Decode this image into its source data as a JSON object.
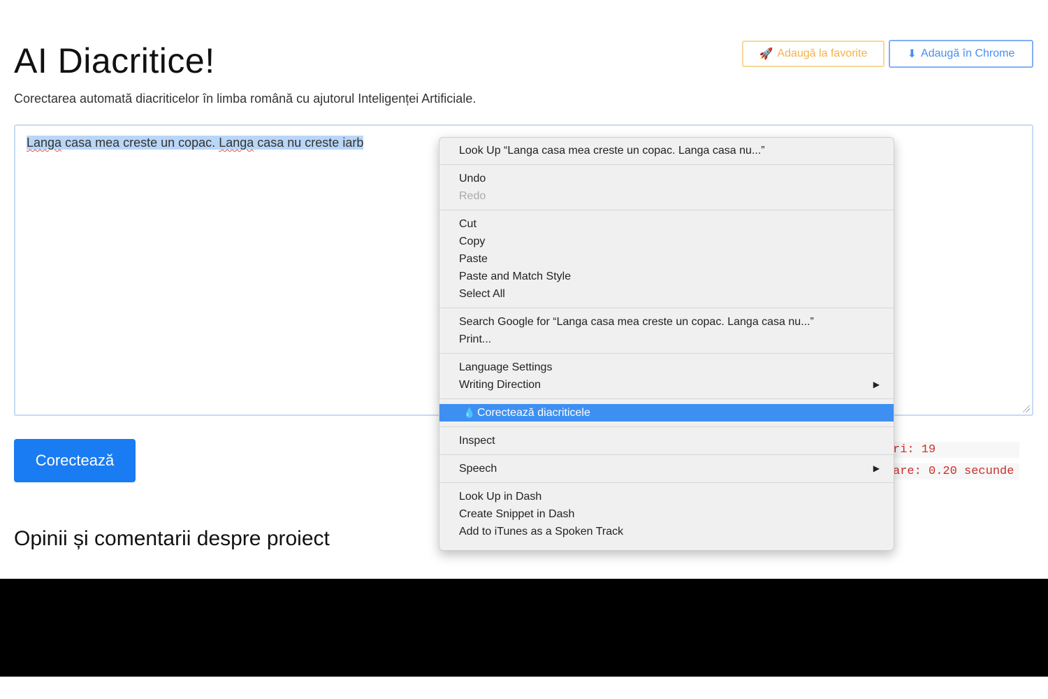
{
  "header": {
    "title": "AI Diacritice!",
    "subtitle": "Corectarea automată diacriticelor în limba română cu ajutorul Inteligenței Artificiale."
  },
  "buttons": {
    "favorites_label": "Adaugă la favorite",
    "chrome_label": "Adaugă în Chrome",
    "correct_label": "Corectează"
  },
  "editor": {
    "w1": "Langa",
    "t1": " casa mea creste un copac. ",
    "w2": "Langa",
    "t2": " casa nu creste iarb"
  },
  "stats": {
    "line1": "ri: 19",
    "line2": "are: 0.20 secunde"
  },
  "section": {
    "heading": "Opinii și comentarii despre proiect"
  },
  "context_menu": {
    "look_up": "Look Up “Langa casa mea creste un copac. Langa casa nu...”",
    "undo": "Undo",
    "redo": "Redo",
    "cut": "Cut",
    "copy": "Copy",
    "paste": "Paste",
    "paste_match": "Paste and Match Style",
    "select_all": "Select All",
    "search_google": "Search Google for “Langa casa mea creste un copac. Langa casa nu...”",
    "print": "Print...",
    "language_settings": "Language Settings",
    "writing_direction": "Writing Direction",
    "correct_diacritics": "Corectează diacriticele",
    "inspect": "Inspect",
    "speech": "Speech",
    "look_up_dash": "Look Up in Dash",
    "create_snippet": "Create Snippet in Dash",
    "add_itunes": "Add to iTunes as a Spoken Track"
  },
  "colors": {
    "primary": "#1a7cf2",
    "warning": "#f3b34a",
    "menu_highlight": "#3d8ff2",
    "stats_text": "#c9302c"
  },
  "icons": {
    "favorites": "rocket-icon",
    "chrome": "download-arrow-icon",
    "menu_item": "drop-icon",
    "submenu": "triangle-right-icon"
  }
}
